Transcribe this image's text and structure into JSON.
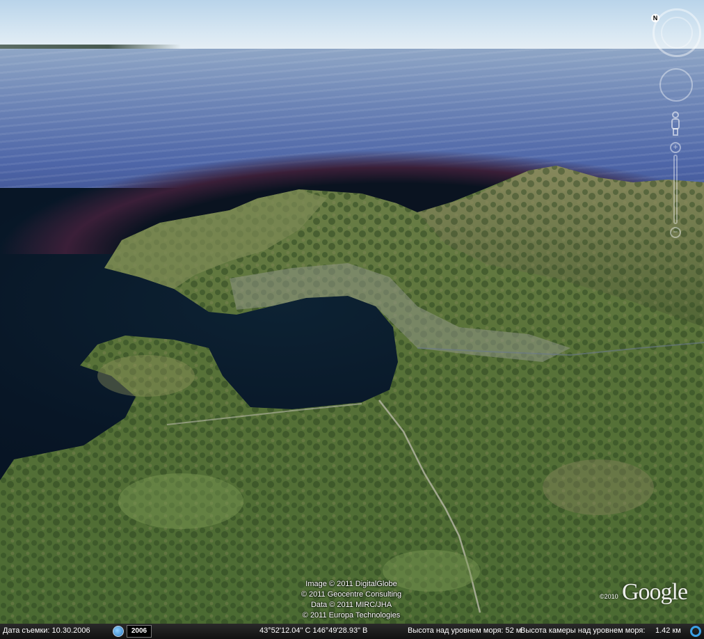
{
  "statusbar": {
    "imagery_date": "Дата съемки: 10.30.2006",
    "history_year": "2006",
    "coordinates": "43°52'12.04\" С  146°49'28.93\" В",
    "elevation": "Высота над уровнем моря:  52 м",
    "camera": "Высота камеры над уровнем моря:",
    "camera_altitude": "1.42 км"
  },
  "credits": [
    "Image © 2011 DigitalGlobe",
    "© 2011 Geocentre Consulting",
    "Data © 2011 MIRC/JHA",
    "© 2011 Europa Technologies"
  ],
  "logo": {
    "year": "©2010",
    "text": "Google"
  },
  "nav": {
    "north_label": "N",
    "zoom_in": "+",
    "zoom_out": "−"
  },
  "colors": {
    "sea": "#4e66a8",
    "bay": "#0a1b2c",
    "land": "#5f7a3c"
  }
}
